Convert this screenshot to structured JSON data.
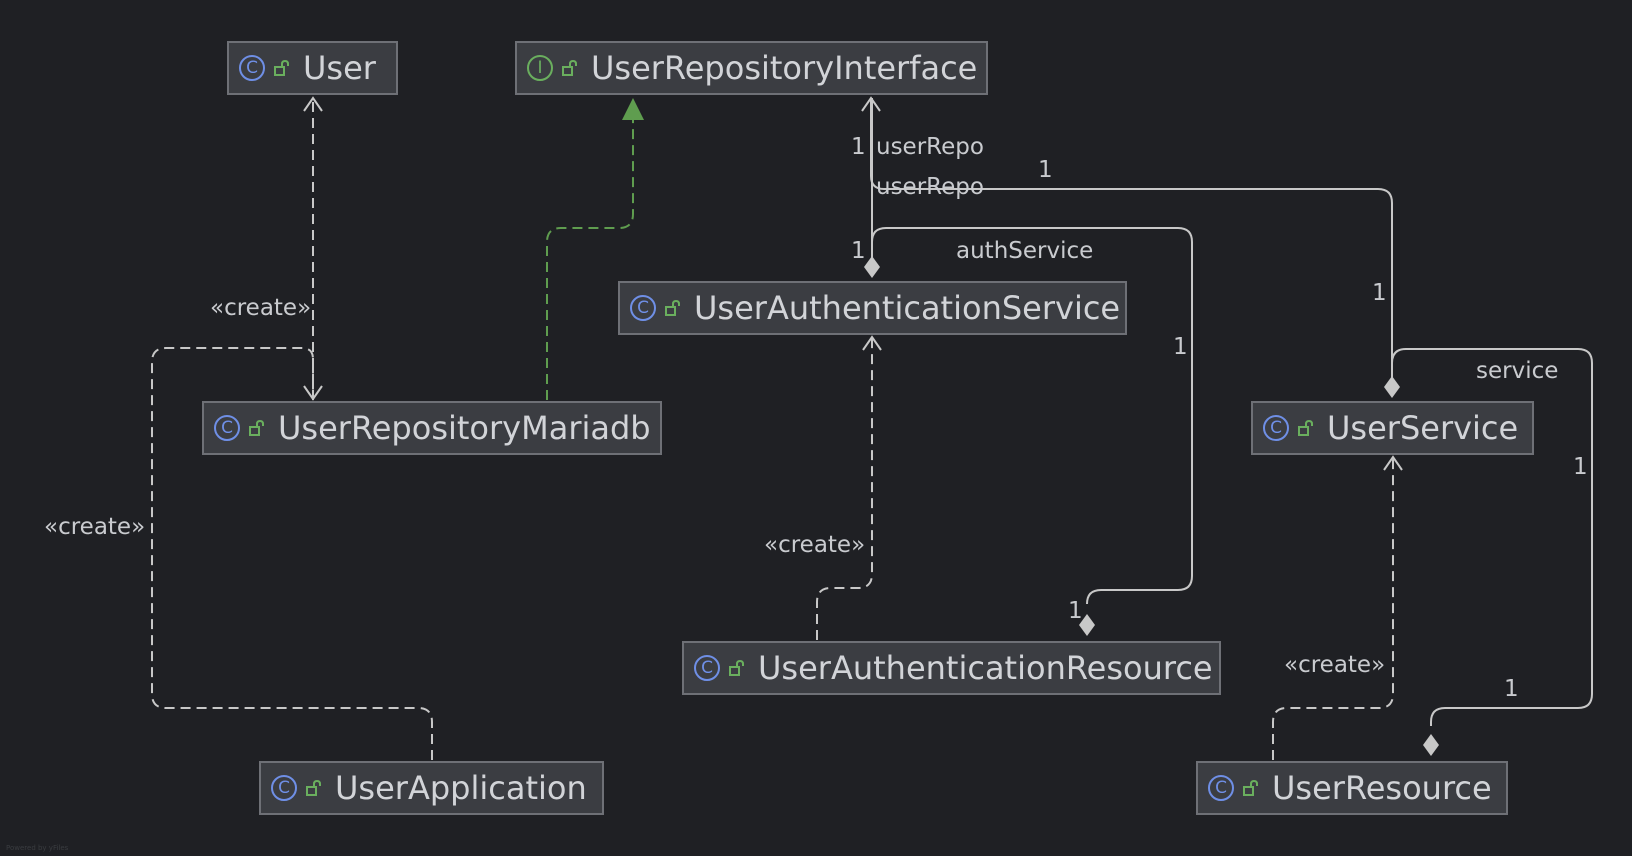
{
  "nodes": {
    "user": {
      "name": "User",
      "kind": "class",
      "kind_symbol": "C"
    },
    "repo_iface": {
      "name": "UserRepositoryInterface",
      "kind": "interface",
      "kind_symbol": "I"
    },
    "auth_service": {
      "name": "UserAuthenticationService",
      "kind": "class",
      "kind_symbol": "C"
    },
    "repo_mariadb": {
      "name": "UserRepositoryMariadb",
      "kind": "class",
      "kind_symbol": "C"
    },
    "user_service": {
      "name": "UserService",
      "kind": "class",
      "kind_symbol": "C"
    },
    "auth_resource": {
      "name": "UserAuthenticationResource",
      "kind": "class",
      "kind_symbol": "C"
    },
    "user_application": {
      "name": "UserApplication",
      "kind": "class",
      "kind_symbol": "C"
    },
    "user_resource": {
      "name": "UserResource",
      "kind": "class",
      "kind_symbol": "C"
    }
  },
  "edge_labels": {
    "create_repo_user": "«create»",
    "create_app_repo": "«create»",
    "create_auth_resource": "«create»",
    "create_user_resource": "«create»",
    "user_repo_auth": "userRepo",
    "user_repo_service": "userRepo",
    "auth_service": "authService",
    "service": "service"
  },
  "multiplicities": {
    "repo_auth_target": "1",
    "repo_auth_source": "1",
    "repo_service_target": "1",
    "repo_service_source": "1",
    "auth_service_target": "1",
    "auth_service_source": "1",
    "service_target": "1",
    "service_source": "1"
  },
  "footer": "Powered by yFiles",
  "colors": {
    "background": "#1f2024",
    "node_fill": "#3b3d42",
    "node_border": "#6e7076",
    "class_icon": "#6f8fe6",
    "interface_icon": "#6aaf5e",
    "edge": "#c8c8c8",
    "realization": "#5f9d4f"
  },
  "icons": {
    "class": "class-circle-icon",
    "interface": "interface-circle-icon",
    "visibility": "public-lock-icon"
  }
}
